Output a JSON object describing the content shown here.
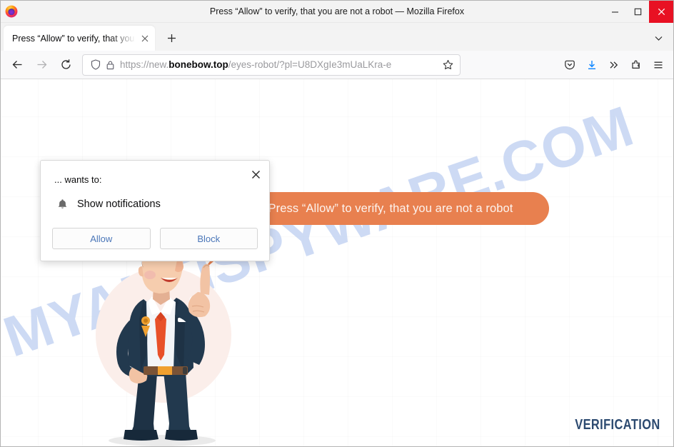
{
  "window": {
    "title": "Press “Allow” to verify, that you are not a robot — Mozilla Firefox",
    "logo_icon": "firefox-logo",
    "minimize_icon": "minimize-icon",
    "maximize_icon": "maximize-icon",
    "close_icon": "close-icon"
  },
  "tabstrip": {
    "tab_title": "Press “Allow” to verify, that you are not a robot",
    "tab_close_icon": "close-icon",
    "new_tab_icon": "plus-icon",
    "list_all_tabs_icon": "chevron-down-icon"
  },
  "navbar": {
    "back_icon": "back-arrow-icon",
    "forward_icon": "forward-arrow-icon",
    "reload_icon": "reload-icon",
    "shield_icon": "shield-icon",
    "lock_icon": "lock-icon",
    "bookmark_icon": "star-icon",
    "url_prefix": "https://new.",
    "url_host": "bonebow.top",
    "url_path": "/eyes-robot/?pl=U8DXgIe3mUaLKra-e",
    "url_full": "https://new.bonebow.top/eyes-robot/?pl=U8DXgIe3mUaLKra-e",
    "pocket_icon": "pocket-icon",
    "downloads_icon": "download-icon",
    "overflow_icon": "double-chevron-icon",
    "extensions_icon": "extensions-icon",
    "menu_icon": "hamburger-menu-icon"
  },
  "popup": {
    "host_text": "... wants to:",
    "permission_icon": "bell-icon",
    "permission_label": "Show notifications",
    "allow_label": "Allow",
    "block_label": "Block",
    "close_icon": "close-icon"
  },
  "page": {
    "bubble_text": "Press “Allow” to verify, that you are not a robot",
    "watermark_text": "MYANTISPYWARE.COM",
    "verification_label": "VERIFICATION",
    "character_icon": "businessman-pointing-illustration"
  },
  "colors": {
    "bubble_orange": "#e8804f",
    "watermark_blue": "#c3d3f2",
    "verification_navy": "#2c4a70",
    "close_button_red": "#e81123",
    "link_blue": "#4a76b8",
    "suit_navy": "#22394e",
    "tie_orange": "#e8512a"
  }
}
